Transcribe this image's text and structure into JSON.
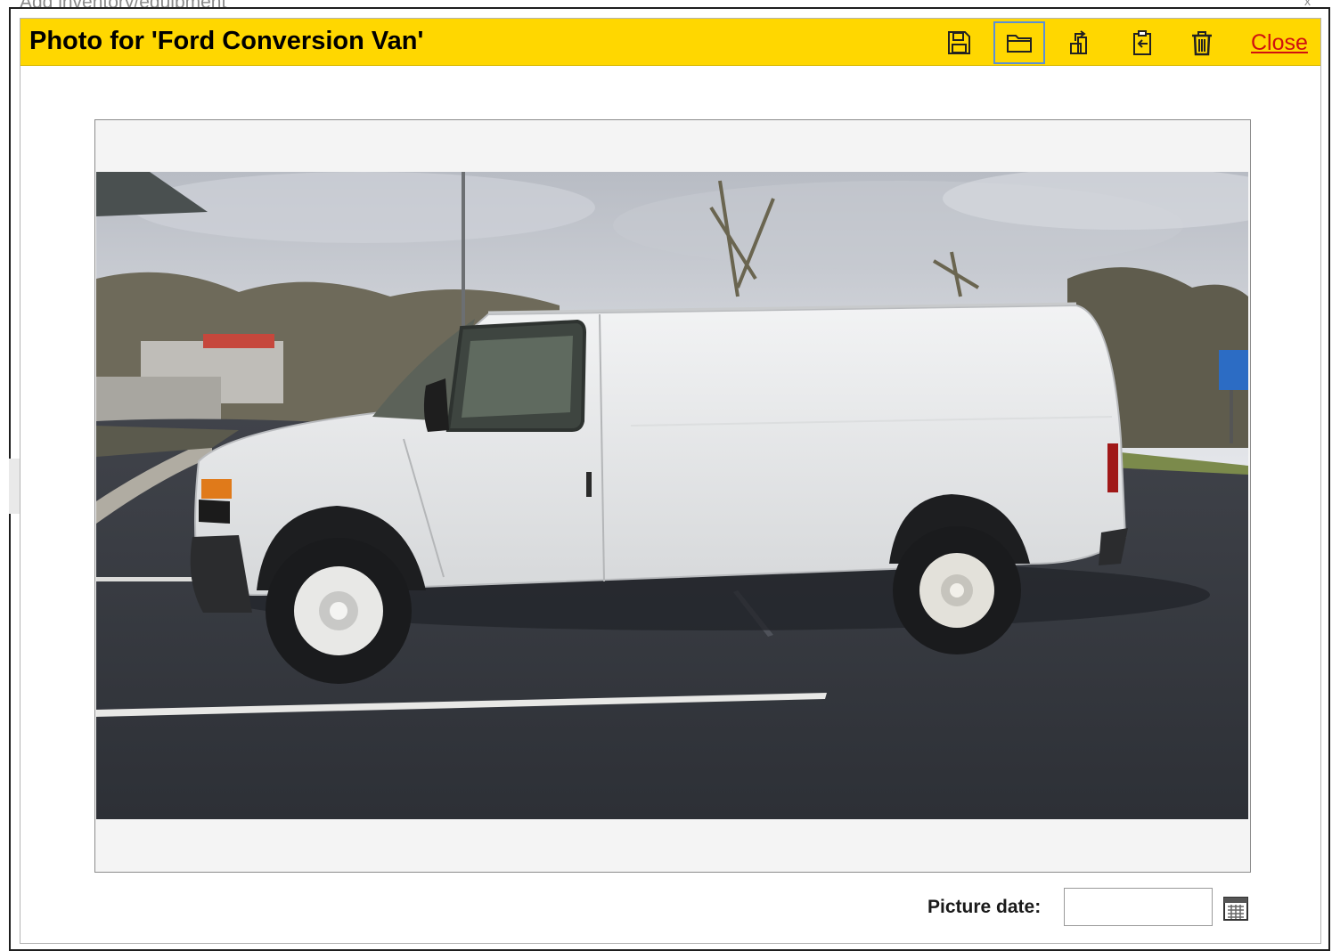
{
  "background": {
    "page_heading": "Add inventory/equipment",
    "page_heading_control": "x"
  },
  "dialog": {
    "title": "Photo for 'Ford Conversion Van'",
    "toolbar": {
      "buttons": [
        {
          "name": "save",
          "icon": "save-icon"
        },
        {
          "name": "open",
          "icon": "folder-open-icon",
          "active": true
        },
        {
          "name": "rotate",
          "icon": "rotate-icon"
        },
        {
          "name": "paste",
          "icon": "clipboard-paste-icon"
        },
        {
          "name": "delete",
          "icon": "trash-icon"
        }
      ],
      "close_label": "Close"
    },
    "photo": {
      "subject": "white van"
    },
    "picture_date": {
      "label": "Picture date:",
      "value": "",
      "calendar_icon": "calendar-icon"
    }
  },
  "colors": {
    "titlebar": "#ffd700",
    "close_link": "#d01010",
    "active_border": "#5a8fd8"
  }
}
